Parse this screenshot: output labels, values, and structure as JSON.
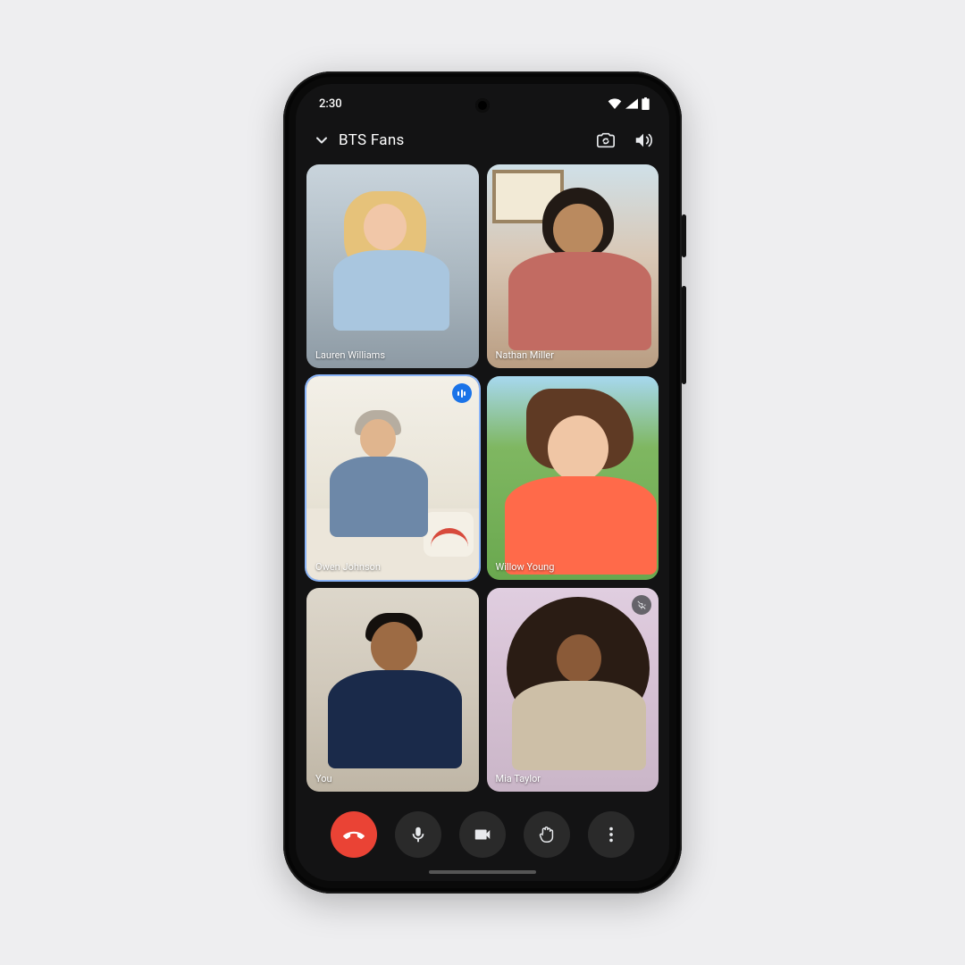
{
  "status": {
    "time": "2:30"
  },
  "header": {
    "title": "BTS  Fans"
  },
  "participants": [
    {
      "name": "Lauren Williams",
      "speaking": false,
      "muted": false
    },
    {
      "name": "Nathan Miller",
      "speaking": false,
      "muted": false
    },
    {
      "name": "Owen Johnson",
      "speaking": true,
      "muted": false
    },
    {
      "name": "Willow Young",
      "speaking": false,
      "muted": false
    },
    {
      "name": "You",
      "speaking": false,
      "muted": false
    },
    {
      "name": "Mia Taylor",
      "speaking": false,
      "muted": true
    }
  ],
  "controls": {
    "end_call": "End call",
    "mic": "Microphone",
    "camera": "Camera",
    "raise_hand": "Raise hand",
    "more": "More options"
  },
  "icons": {
    "collapse": "chevron-down",
    "switch_camera": "camera-switch",
    "speaker": "speaker"
  },
  "colors": {
    "end_call": "#ea4335",
    "speaking_border": "#8ab4f8"
  }
}
